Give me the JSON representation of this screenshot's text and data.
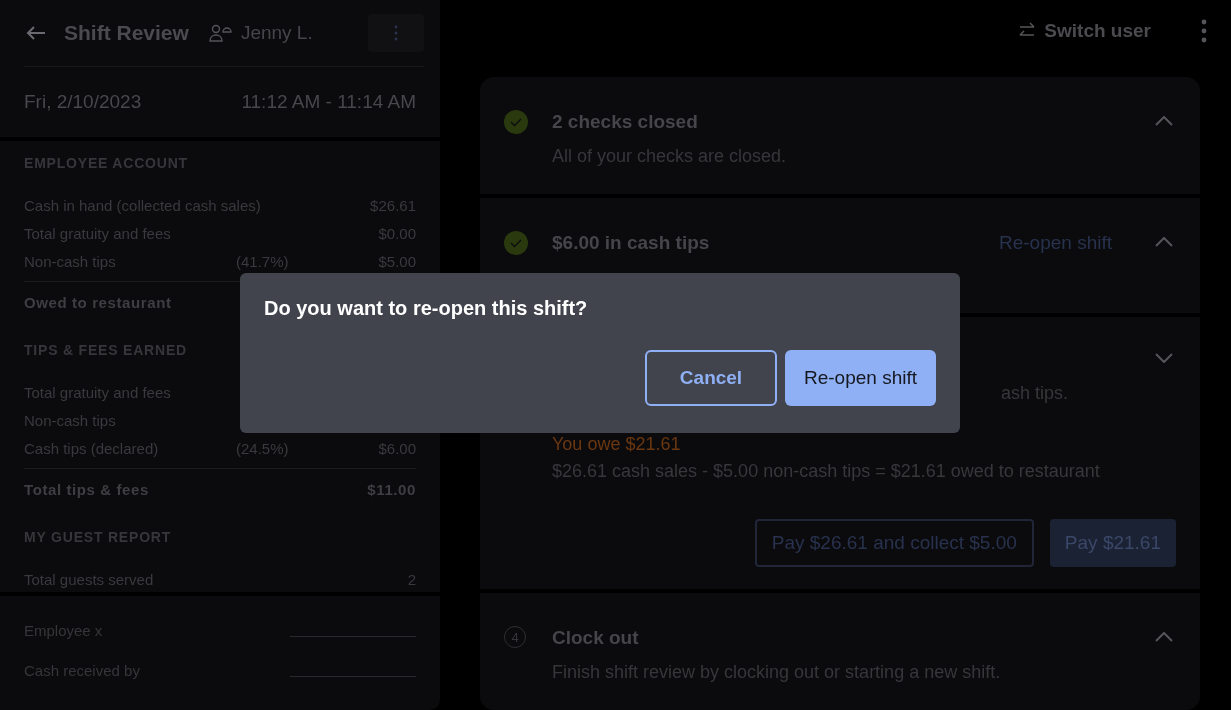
{
  "sidebar": {
    "title": "Shift Review",
    "employee": "Jenny L.",
    "date": "Fri, 2/10/2023",
    "time_range": "11:12 AM - 11:14 AM",
    "sections": [
      {
        "heading": "EMPLOYEE ACCOUNT",
        "rows": [
          {
            "label": "Cash in hand (collected cash sales)",
            "value": "$26.61"
          },
          {
            "label": "Total gratuity and fees",
            "value": "$0.00"
          },
          {
            "label": "Non-cash tips",
            "percent": "(41.7%)",
            "value": "$5.00"
          }
        ],
        "total": {
          "label": "Owed to restaurant"
        }
      },
      {
        "heading": "TIPS & FEES EARNED",
        "rows": [
          {
            "label": "Total gratuity and fees"
          },
          {
            "label": "Non-cash tips"
          },
          {
            "label": "Cash tips (declared)",
            "percent": "(24.5%)",
            "value": "$6.00"
          }
        ],
        "total": {
          "label": "Total tips & fees",
          "value": "$11.00"
        }
      },
      {
        "heading": "MY GUEST REPORT",
        "rows": [
          {
            "label": "Total guests served",
            "value": "2"
          }
        ]
      }
    ],
    "signatures": [
      "Employee x",
      "Cash received by"
    ]
  },
  "top_bar": {
    "switch_user": "Switch user"
  },
  "steps": [
    {
      "kind": "done",
      "title": "2 checks closed",
      "description": "All of your checks are closed.",
      "expanded": true
    },
    {
      "kind": "done",
      "title": "$6.00 in cash tips",
      "link": "Re-open shift",
      "expanded": true
    },
    {
      "kind": "covered",
      "description": "ash tips.",
      "owe": "You owe $21.61",
      "formula": "$26.61 cash sales - $5.00 non-cash tips = $21.61 owed to restaurant",
      "buttons": [
        {
          "label": "Pay $26.61 and collect $5.00",
          "kind": "outline"
        },
        {
          "label": "Pay $21.61",
          "kind": "filled"
        }
      ],
      "expanded": false
    },
    {
      "kind": "numbered",
      "number": "4",
      "title": "Clock out",
      "description": "Finish shift review by clocking out or starting a new shift.",
      "expanded": true
    }
  ],
  "dialog": {
    "title": "Do you want to re-open this shift?",
    "buttons": [
      {
        "label": "Cancel",
        "kind": "outline"
      },
      {
        "label": "Re-open shift",
        "kind": "filled"
      }
    ]
  }
}
